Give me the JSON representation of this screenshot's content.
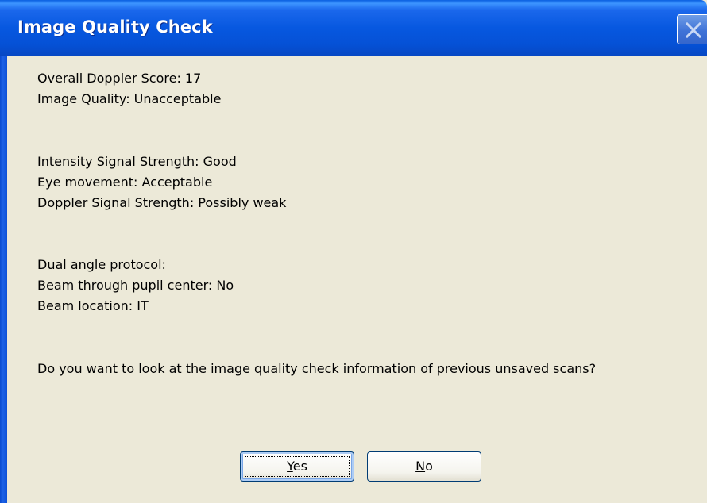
{
  "window": {
    "title": "Image Quality Check"
  },
  "message": {
    "overall_score": "Overall Doppler Score: 17",
    "image_quality": "Image Quality: Unacceptable",
    "intensity": "Intensity Signal Strength: Good",
    "eye_movement": "Eye movement: Acceptable",
    "doppler_strength": "Doppler Signal Strength: Possibly weak",
    "dual_angle": "Dual angle protocol:",
    "beam_pupil": "Beam through pupil center: No",
    "beam_location": "Beam location: IT",
    "question": "Do you want to look at the image quality check information of previous unsaved scans?"
  },
  "buttons": {
    "yes": {
      "mnemonic": "Y",
      "rest": "es"
    },
    "no": {
      "mnemonic": "N",
      "rest": "o"
    }
  },
  "icons": {
    "close": "close-icon"
  },
  "colors": {
    "titlebar": "#0758e0",
    "body": "#ece9d8",
    "button_border": "#003c74"
  }
}
